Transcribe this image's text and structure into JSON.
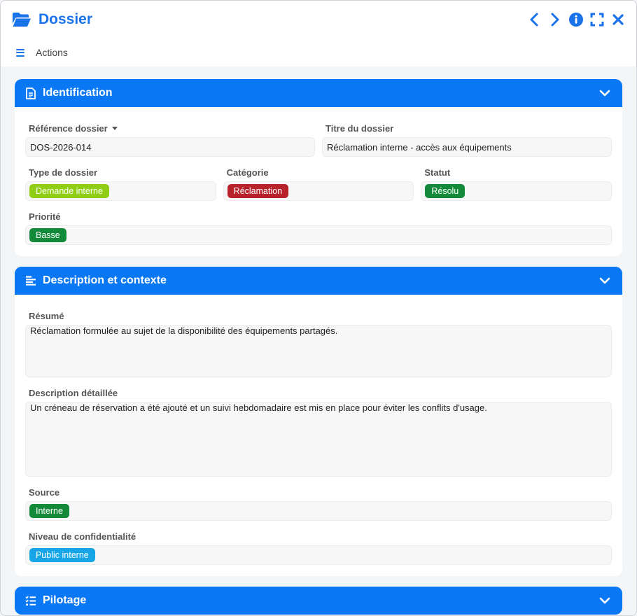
{
  "window": {
    "title": "Dossier",
    "actions_label": "Actions"
  },
  "sections": {
    "identification": {
      "title": "Identification",
      "fields": {
        "reference": {
          "label": "Référence dossier",
          "value": "DOS-2026-014"
        },
        "titre": {
          "label": "Titre du dossier",
          "value": "Réclamation interne - accès aux équipements"
        },
        "type": {
          "label": "Type de dossier",
          "value": "Demande interne",
          "color": "#8fce14"
        },
        "categorie": {
          "label": "Catégorie",
          "value": "Réclamation",
          "color": "#b8232b"
        },
        "statut": {
          "label": "Statut",
          "value": "Résolu",
          "color": "#138a3a"
        },
        "priorite": {
          "label": "Priorité",
          "value": "Basse",
          "color": "#138a3a"
        }
      }
    },
    "description": {
      "title": "Description et contexte",
      "fields": {
        "resume": {
          "label": "Résumé",
          "value": "Réclamation formulée au sujet de la disponibilité des équipements partagés."
        },
        "detail": {
          "label": "Description détaillée",
          "value": "Un créneau de réservation a été ajouté et un suivi hebdomadaire est mis en place pour éviter les conflits d'usage."
        },
        "source": {
          "label": "Source",
          "value": "Interne",
          "color": "#138a3a"
        },
        "confidentialite": {
          "label": "Niveau de confidentialité",
          "value": "Public interne",
          "color": "#16a6e8"
        }
      }
    },
    "pilotage": {
      "title": "Pilotage"
    }
  },
  "colors": {
    "accent": "#1a73e8",
    "section_header": "#0a78f5"
  },
  "icons": [
    "folder-open-icon",
    "chevron-left-icon",
    "chevron-right-icon",
    "info-icon",
    "expand-icon",
    "close-icon",
    "menu-icon",
    "document-icon",
    "align-left-icon",
    "list-check-icon",
    "chevron-down-icon",
    "caret-down-icon"
  ]
}
